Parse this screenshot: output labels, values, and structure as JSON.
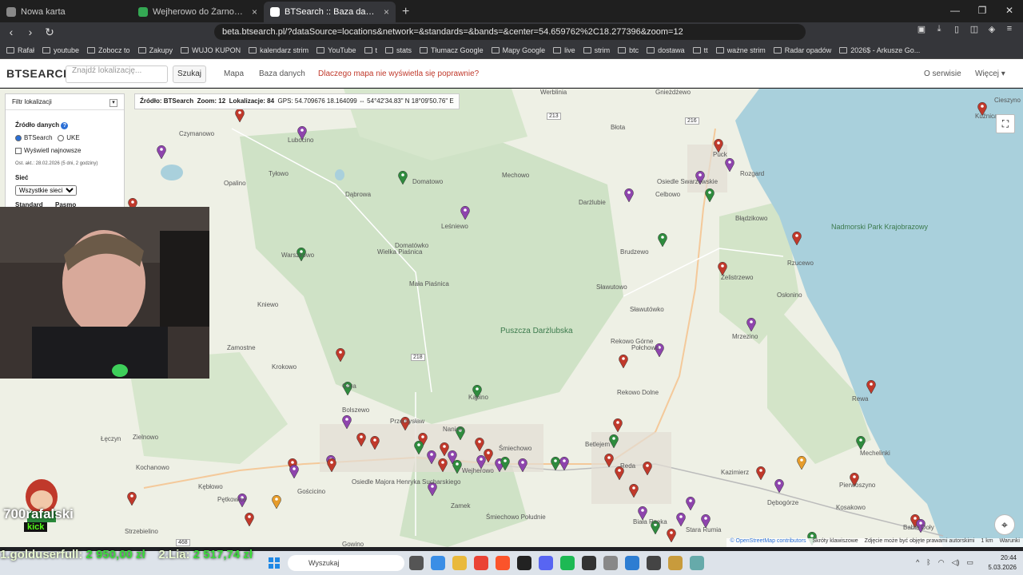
{
  "browser": {
    "tabs": [
      {
        "title": "Nowa karta"
      },
      {
        "title": "Wejherowo do Żarnowiec – Mapy Go"
      },
      {
        "title": "BTSearch :: Baza danych oraz mapa"
      }
    ],
    "url": "beta.btsearch.pl/?dataSource=locations&network=&standards=&bands=&center=54.659762%2C18.277396&zoom=12",
    "bookmarks": [
      "Rafał",
      "youtube",
      "Zobocz to",
      "Zakupy",
      "WUJO KUPON",
      "kalendarz strim",
      "YouTube",
      "t",
      "stats",
      "Tłumacz Google",
      "Mapy Google",
      "live",
      "strim",
      "btc",
      "dostawa",
      "tt",
      "ważne strim",
      "Radar opadów",
      "2026$ - Arkusze Go..."
    ]
  },
  "site": {
    "logo": "BTSEARCH",
    "search_placeholder": "Znajdź lokalizację...",
    "search_button": "Szukaj",
    "nav": {
      "map": "Mapa",
      "db": "Baza danych",
      "why": "Dlaczego mapa nie wyświetla się poprawnie?",
      "about": "O serwisie",
      "more": "Więcej"
    }
  },
  "filter": {
    "title": "Filtr lokalizacji",
    "source_label": "Źródło danych",
    "source_btsearch": "BTSearch",
    "source_uke": "UKE",
    "show_newest": "Wyświetl najnowsze",
    "updated": "Ost. akt.: 28.02.2026 (5 dni, 2 godziny)",
    "network_label": "Sieć",
    "network_value": "Wszystkie sieci",
    "standard_label": "Standard",
    "band_label": "Pasmo"
  },
  "gps_bar": {
    "source": "Źródło: BTSearch",
    "zoom": "Zoom: 12",
    "locations": "Lokalizacje: 84",
    "gps": "GPS: 54.709676 18.164099 ⇔ 54°42'34.83\" N 18°09'50.76\" E"
  },
  "map_labels": {
    "places": [
      "Czymanowo",
      "Lubocino",
      "Domatowo",
      "Dąbrowa",
      "Tyłowo",
      "Opalino",
      "Leśniewo",
      "Mechowo",
      "Werblinia",
      "Gnieżdżewo",
      "Warszkowo",
      "Wielka Piaśnica",
      "Domatówko",
      "Mała Piaśnica",
      "Darżlubie",
      "Brudzewo",
      "Celbowo",
      "Puck",
      "Rozgard",
      "Osiedle Swarzewskie",
      "Błądzikowo",
      "Rzucewo",
      "Żelistrzewo",
      "Sławutowo",
      "Sławutówko",
      "Osłonino",
      "Mrzezino",
      "Krokowo",
      "Kniewo",
      "Zamostne",
      "Puszcza Darżlubska",
      "Rekowo Górne",
      "Połchowo",
      "Rekowo Dolne",
      "Kazimierz",
      "Rewa",
      "Mechelinki",
      "Góra",
      "Bolszewo",
      "Przemysław",
      "Kąpino",
      "Nanice",
      "Śmiechowo",
      "Betlejem",
      "Reda",
      "Pierwoszyno",
      "Osiedle Majora Henryka Sucharskiego",
      "Gościcino",
      "Wejherowo",
      "Łęczyn",
      "Zielnowo",
      "Kochanowo",
      "Kębłowo",
      "Pętkowice",
      "Zamek",
      "Śmiechowo Południe",
      "Dębogórze",
      "Kosakowo",
      "Biała Rzeka",
      "Stara Rumia",
      "Babie Doły",
      "Gowino",
      "Strzebielino",
      "Kuźnica",
      "Cieszyno",
      "Błota"
    ],
    "park1": "Nadmorski Park Krajobrazowy",
    "road_numbers": [
      "213",
      "216",
      "218",
      "468"
    ]
  },
  "attribution": {
    "osm": "© OpenStreetMap contributors",
    "shortcuts": "Skróty klawiszowe",
    "note": "Zdjęcie może być objęte prawami autorskimi",
    "scale": "1 km",
    "terms": "Warunki"
  },
  "ticker": {
    "first": "1.golduserfull:",
    "first_amount": "2 950,00 zł",
    "second": "2.Lia:",
    "second_amount": "2 517,74 zł"
  },
  "streamer": {
    "name": "700rafalski",
    "sub": "kick"
  },
  "taskbar": {
    "search": "Wyszukaj",
    "time": "20:44",
    "date": "5.03.2026"
  },
  "colors": {
    "accent": "#c0392b",
    "sea": "#a9d0dc",
    "forest": "#cfe2c6",
    "land": "#eef0e5"
  }
}
